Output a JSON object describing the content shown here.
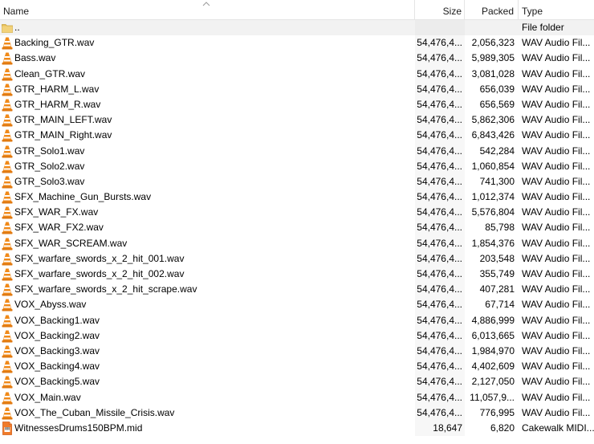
{
  "columns": {
    "name": "Name",
    "size": "Size",
    "packed": "Packed",
    "type": "Type"
  },
  "rows": [
    {
      "name": "..",
      "size": "",
      "packed": "",
      "type": "File folder",
      "icon": "folder-icon"
    },
    {
      "name": "Backing_GTR.wav",
      "size": "54,476,4...",
      "packed": "2,056,323",
      "type": "WAV Audio Fil...",
      "icon": "vlc-cone-icon"
    },
    {
      "name": "Bass.wav",
      "size": "54,476,4...",
      "packed": "5,989,305",
      "type": "WAV Audio Fil...",
      "icon": "vlc-cone-icon"
    },
    {
      "name": "Clean_GTR.wav",
      "size": "54,476,4...",
      "packed": "3,081,028",
      "type": "WAV Audio Fil...",
      "icon": "vlc-cone-icon"
    },
    {
      "name": "GTR_HARM_L.wav",
      "size": "54,476,4...",
      "packed": "656,039",
      "type": "WAV Audio Fil...",
      "icon": "vlc-cone-icon"
    },
    {
      "name": "GTR_HARM_R.wav",
      "size": "54,476,4...",
      "packed": "656,569",
      "type": "WAV Audio Fil...",
      "icon": "vlc-cone-icon"
    },
    {
      "name": "GTR_MAIN_LEFT.wav",
      "size": "54,476,4...",
      "packed": "5,862,306",
      "type": "WAV Audio Fil...",
      "icon": "vlc-cone-icon"
    },
    {
      "name": "GTR_MAIN_Right.wav",
      "size": "54,476,4...",
      "packed": "6,843,426",
      "type": "WAV Audio Fil...",
      "icon": "vlc-cone-icon"
    },
    {
      "name": "GTR_Solo1.wav",
      "size": "54,476,4...",
      "packed": "542,284",
      "type": "WAV Audio Fil...",
      "icon": "vlc-cone-icon"
    },
    {
      "name": "GTR_Solo2.wav",
      "size": "54,476,4...",
      "packed": "1,060,854",
      "type": "WAV Audio Fil...",
      "icon": "vlc-cone-icon"
    },
    {
      "name": "GTR_Solo3.wav",
      "size": "54,476,4...",
      "packed": "741,300",
      "type": "WAV Audio Fil...",
      "icon": "vlc-cone-icon"
    },
    {
      "name": "SFX_Machine_Gun_Bursts.wav",
      "size": "54,476,4...",
      "packed": "1,012,374",
      "type": "WAV Audio Fil...",
      "icon": "vlc-cone-icon"
    },
    {
      "name": "SFX_WAR_FX.wav",
      "size": "54,476,4...",
      "packed": "5,576,804",
      "type": "WAV Audio Fil...",
      "icon": "vlc-cone-icon"
    },
    {
      "name": "SFX_WAR_FX2.wav",
      "size": "54,476,4...",
      "packed": "85,798",
      "type": "WAV Audio Fil...",
      "icon": "vlc-cone-icon"
    },
    {
      "name": "SFX_WAR_SCREAM.wav",
      "size": "54,476,4...",
      "packed": "1,854,376",
      "type": "WAV Audio Fil...",
      "icon": "vlc-cone-icon"
    },
    {
      "name": "SFX_warfare_swords_x_2_hit_001.wav",
      "size": "54,476,4...",
      "packed": "203,548",
      "type": "WAV Audio Fil...",
      "icon": "vlc-cone-icon"
    },
    {
      "name": "SFX_warfare_swords_x_2_hit_002.wav",
      "size": "54,476,4...",
      "packed": "355,749",
      "type": "WAV Audio Fil...",
      "icon": "vlc-cone-icon"
    },
    {
      "name": "SFX_warfare_swords_x_2_hit_scrape.wav",
      "size": "54,476,4...",
      "packed": "407,281",
      "type": "WAV Audio Fil...",
      "icon": "vlc-cone-icon"
    },
    {
      "name": "VOX_Abyss.wav",
      "size": "54,476,4...",
      "packed": "67,714",
      "type": "WAV Audio Fil...",
      "icon": "vlc-cone-icon"
    },
    {
      "name": "VOX_Backing1.wav",
      "size": "54,476,4...",
      "packed": "4,886,999",
      "type": "WAV Audio Fil...",
      "icon": "vlc-cone-icon"
    },
    {
      "name": "VOX_Backing2.wav",
      "size": "54,476,4...",
      "packed": "6,013,665",
      "type": "WAV Audio Fil...",
      "icon": "vlc-cone-icon"
    },
    {
      "name": "VOX_Backing3.wav",
      "size": "54,476,4...",
      "packed": "1,984,970",
      "type": "WAV Audio Fil...",
      "icon": "vlc-cone-icon"
    },
    {
      "name": "VOX_Backing4.wav",
      "size": "54,476,4...",
      "packed": "4,402,609",
      "type": "WAV Audio Fil...",
      "icon": "vlc-cone-icon"
    },
    {
      "name": "VOX_Backing5.wav",
      "size": "54,476,4...",
      "packed": "2,127,050",
      "type": "WAV Audio Fil...",
      "icon": "vlc-cone-icon"
    },
    {
      "name": "VOX_Main.wav",
      "size": "54,476,4...",
      "packed": "11,057,9...",
      "type": "WAV Audio Fil...",
      "icon": "vlc-cone-icon"
    },
    {
      "name": "VOX_The_Cuban_Missile_Crisis.wav",
      "size": "54,476,4...",
      "packed": "776,995",
      "type": "WAV Audio Fil...",
      "icon": "vlc-cone-icon"
    },
    {
      "name": "WitnessesDrums150BPM.mid",
      "size": "18,647",
      "packed": "6,820",
      "type": "Cakewalk MIDI...",
      "icon": "midi-file-icon"
    }
  ],
  "colors": {
    "folder": "#e8c25a",
    "vlc_orange": "#f08a1a",
    "midi_orange": "#f07b2a"
  }
}
